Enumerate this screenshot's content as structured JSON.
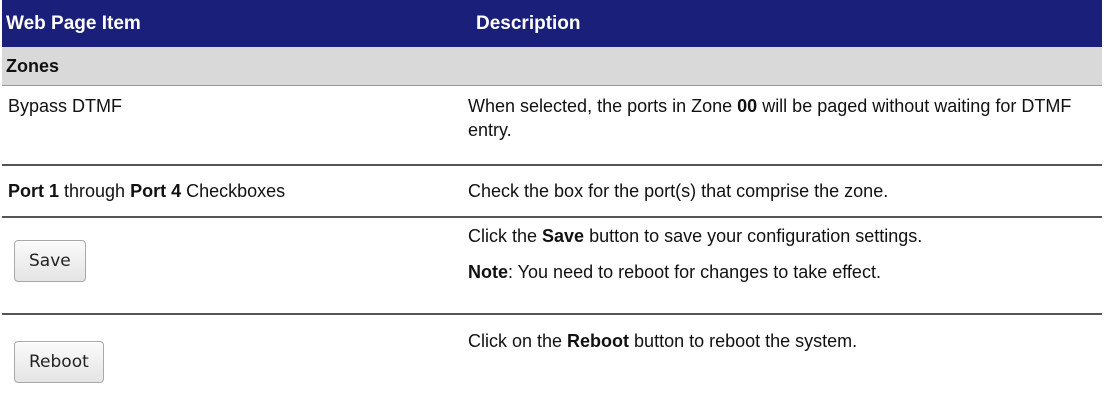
{
  "header": {
    "col1": "Web Page Item",
    "col2": "Description"
  },
  "section": {
    "title": "Zones"
  },
  "rows": {
    "bypass": {
      "item": "Bypass DTMF",
      "desc_pre": "When selected, the ports in Zone ",
      "desc_bold": "00",
      "desc_post": " will be paged without waiting for DTMF entry."
    },
    "ports": {
      "item_bold1": "Port 1",
      "item_mid": " through ",
      "item_bold2": "Port 4",
      "item_post": " Checkboxes",
      "desc": "Check the box for the port(s) that comprise the zone."
    },
    "save": {
      "button_label": "Save",
      "desc_pre": "Click the ",
      "desc_bold": "Save",
      "desc_post": " button to save your configuration settings.",
      "note_bold": "Note",
      "note_text": ": You need to reboot for changes to take effect."
    },
    "reboot": {
      "button_label": "Reboot",
      "desc_pre": "Click on the ",
      "desc_bold": "Reboot",
      "desc_post": " button to reboot the system."
    }
  },
  "colors": {
    "header_bg": "#1a1f7a",
    "section_bg": "#d9d9d9"
  }
}
